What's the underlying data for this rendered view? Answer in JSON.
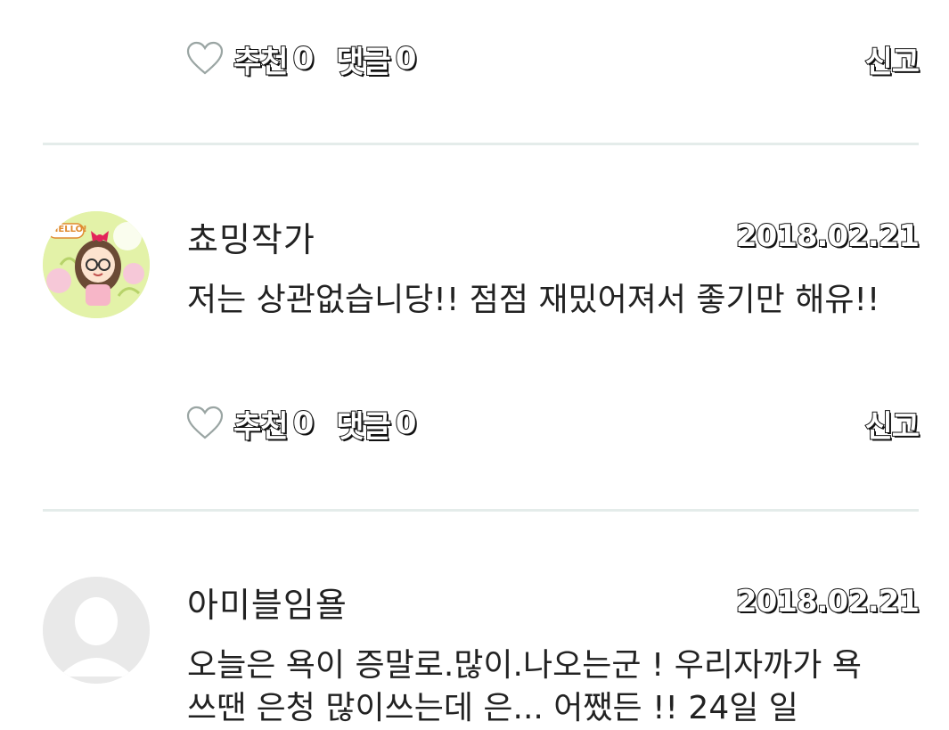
{
  "top_actions": {
    "like_label": "추천",
    "like_count": "0",
    "comment_label": "댓글",
    "comment_count": "0",
    "report_label": "신고"
  },
  "comments": [
    {
      "author": "쵸밍작가",
      "date": "2018.02.21",
      "text": "저는 상관없습니당!! 점점 재밌어져서 좋기만 해유!!",
      "avatar_text": "HELLO!",
      "like_label": "추천",
      "like_count": "0",
      "comment_label": "댓글",
      "comment_count": "0",
      "report_label": "신고"
    },
    {
      "author": "아미블임욜",
      "date": "2018.02.21",
      "text": "오늘은 욕이 증말로.많이.나오는군 ! 우리자까가 욕 쓰땐 은청 많이쓰는데 은... 어쨌든 !! 24일 일"
    }
  ],
  "colors": {
    "divider": "#e4ecea",
    "text": "#222222",
    "heart_outline": "#9aa5a3",
    "avatar_placeholder": "#e9e9e9"
  }
}
